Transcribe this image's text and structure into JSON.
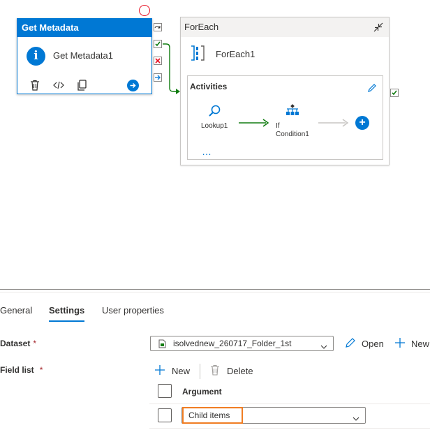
{
  "canvas": {
    "get_metadata": {
      "header": "Get Metadata",
      "name": "Get Metadata1",
      "icons": [
        "info-icon",
        "delete-icon",
        "code-icon",
        "copy-icon",
        "go-arrow-icon"
      ]
    },
    "foreach": {
      "header": "ForEach",
      "name": "ForEach1",
      "activities_title": "Activities",
      "activities": [
        {
          "label": "Lookup1",
          "icon": "search-icon"
        },
        {
          "label": "If\nCondition1",
          "icon": "if-condition-icon"
        }
      ],
      "add_symbol": "+",
      "more": "…"
    }
  },
  "panel": {
    "tabs": [
      {
        "label": "General",
        "active": false
      },
      {
        "label": "Settings",
        "active": true
      },
      {
        "label": "User properties",
        "active": false
      }
    ],
    "dataset": {
      "label": "Dataset",
      "required_mark": "*",
      "value": "isolvednew_260717_Folder_1st",
      "open_label": "Open",
      "new_label": "New"
    },
    "field_list": {
      "label": "Field list",
      "required_mark": "*",
      "new_label": "New",
      "delete_label": "Delete",
      "column_header": "Argument",
      "rows": [
        {
          "value": "Child items"
        }
      ]
    }
  },
  "colors": {
    "accent": "#0078d4",
    "success": "#107c10",
    "error": "#e81123",
    "highlight": "#f07d23"
  }
}
